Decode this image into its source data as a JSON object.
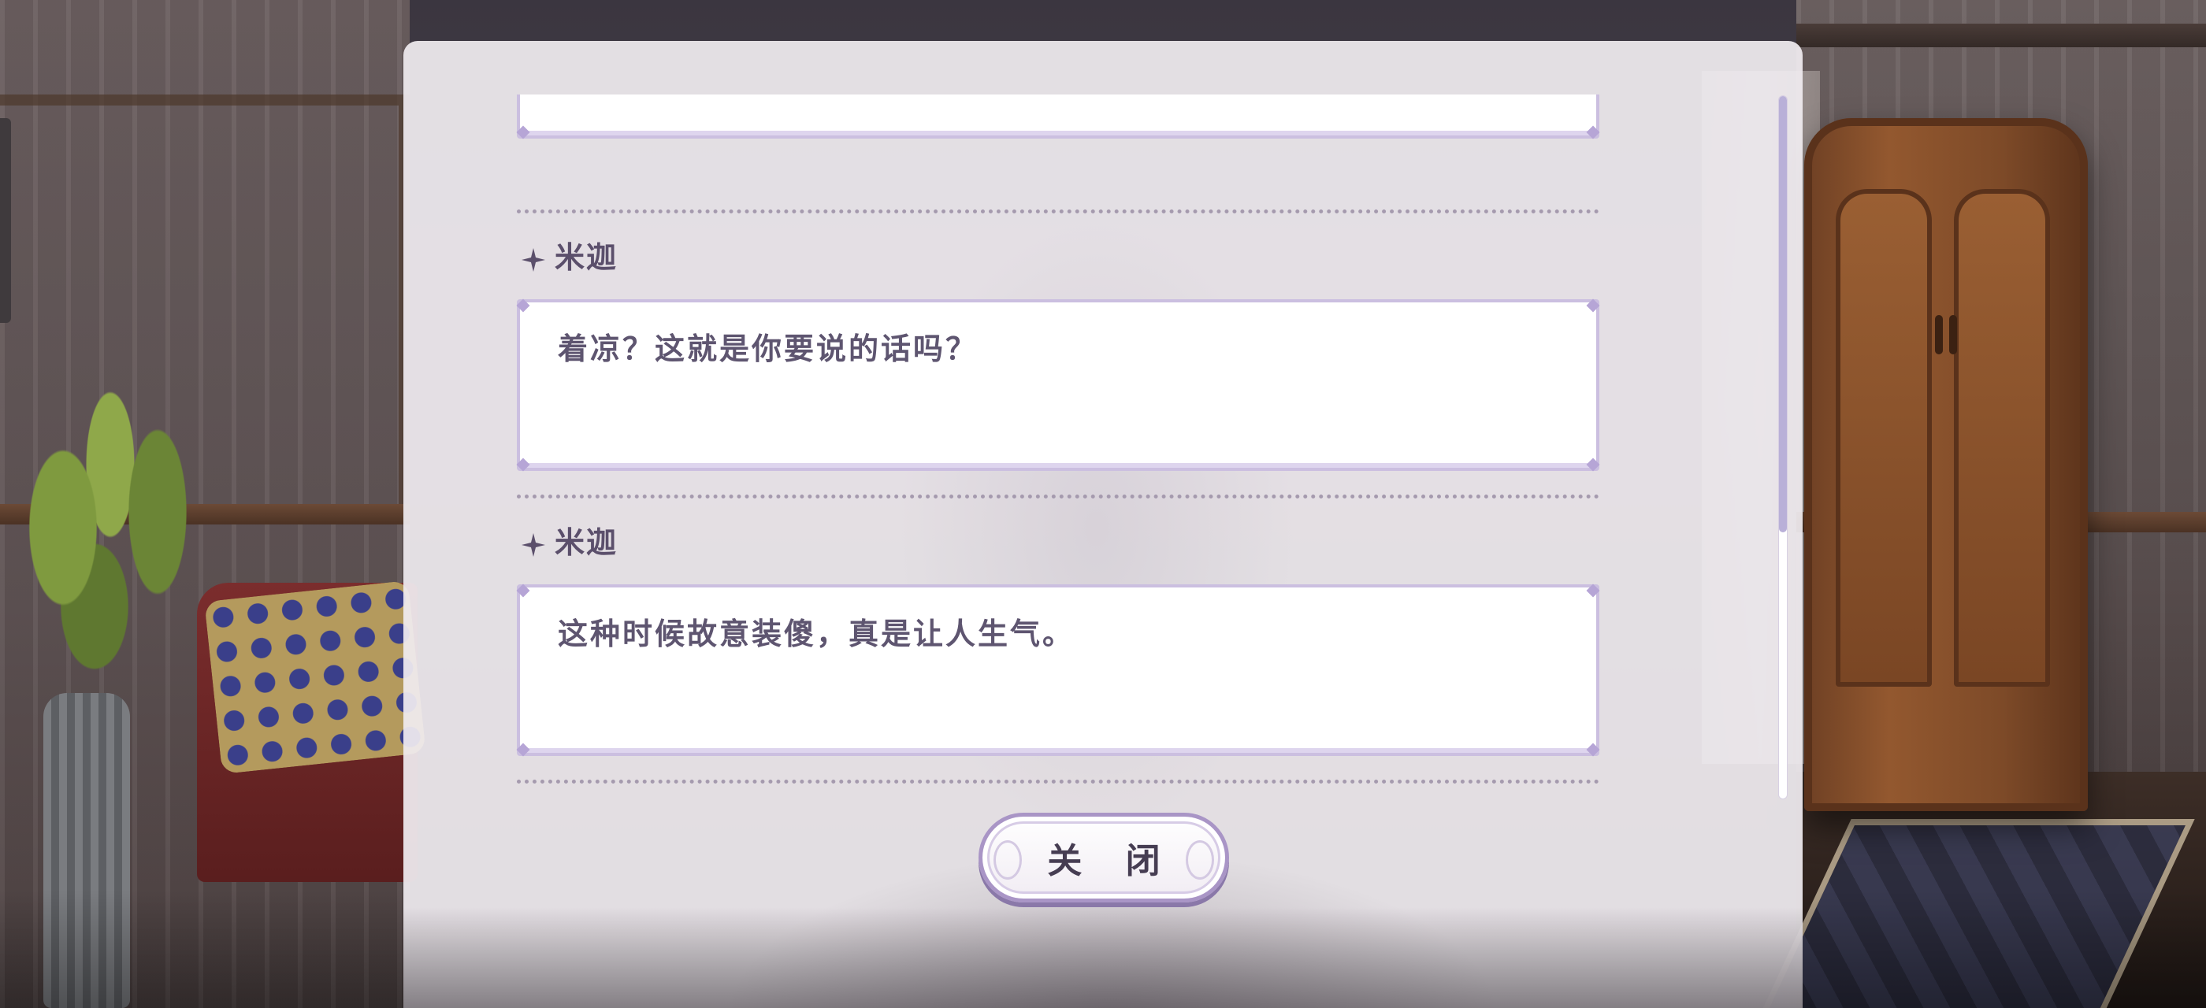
{
  "log": {
    "entries": [
      {
        "speaker": "",
        "text": ""
      },
      {
        "speaker": "米迦",
        "text": "着凉？这就是你要说的话吗？"
      },
      {
        "speaker": "米迦",
        "text": "这种时候故意装傻，真是让人生气。"
      }
    ]
  },
  "buttons": {
    "close_label": "关 闭"
  },
  "scroll": {
    "position_fraction": 0.62
  },
  "colors": {
    "panel_bg": "#f0ecf0",
    "box_border": "#cbbfe0",
    "text": "#5e5570",
    "speaker": "#5b4f6b",
    "scroll_thumb": "#b9b0d8"
  }
}
